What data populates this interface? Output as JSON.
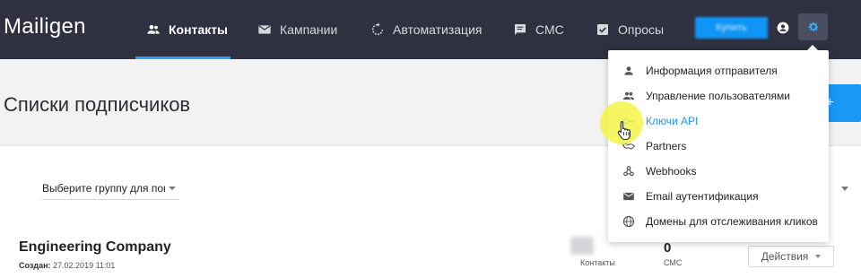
{
  "app": {
    "logo": "Mailigen"
  },
  "nav": {
    "items": [
      {
        "label": "Контакты",
        "icon": "contacts-icon",
        "active": true
      },
      {
        "label": "Кампании",
        "icon": "mail-icon",
        "active": false
      },
      {
        "label": "Автоматизация",
        "icon": "refresh-icon",
        "active": false
      },
      {
        "label": "СМС",
        "icon": "sms-icon",
        "active": false
      },
      {
        "label": "Опросы",
        "icon": "checkbox-icon",
        "active": false
      }
    ],
    "upgrade_label": "Купить",
    "user_icon": "user-icon",
    "settings_icon": "gear-icon"
  },
  "page": {
    "title": "Списки подписчиков",
    "add_label": "+",
    "group_select": {
      "value": "Выберите группу для пока"
    }
  },
  "list": {
    "name": "Engineering Company",
    "created_label": "Создан:",
    "created_value": "27.02.2019 11:01",
    "stats": [
      {
        "label": "Контакты",
        "value": ""
      },
      {
        "label": "СМС",
        "value": "0"
      }
    ],
    "actions_label": "Действия"
  },
  "settings_menu": {
    "items": [
      {
        "label": "Информация отправителя",
        "icon": "person-icon"
      },
      {
        "label": "Управление пользователями",
        "icon": "people-icon"
      },
      {
        "label": "Ключи API",
        "icon": "key-icon",
        "highlighted": true
      },
      {
        "label": "Partners",
        "icon": "handshake-icon"
      },
      {
        "label": "Webhooks",
        "icon": "webhook-icon"
      },
      {
        "label": "Email аутентификация",
        "icon": "email-icon"
      },
      {
        "label": "Домены для отслеживания кликов",
        "icon": "globe-icon"
      }
    ]
  },
  "colors": {
    "topbar": "#2f3140",
    "accent": "#1a98f5",
    "highlight": "#f5f546"
  }
}
